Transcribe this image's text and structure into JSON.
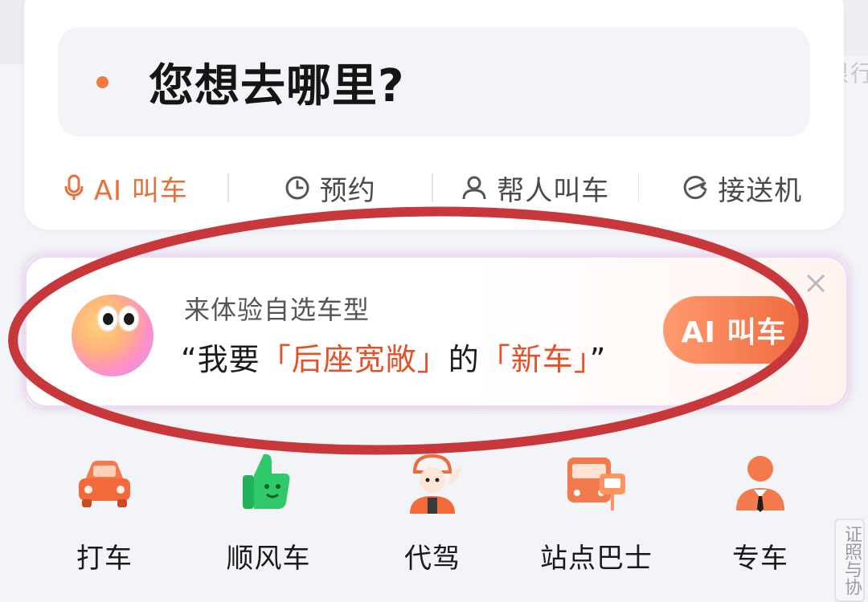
{
  "search": {
    "placeholder": "您想去哪里?"
  },
  "quick_actions": [
    {
      "label": "AI 叫车",
      "icon": "microphone-icon",
      "active": true
    },
    {
      "label": "预约",
      "icon": "clock-icon",
      "active": false
    },
    {
      "label": "帮人叫车",
      "icon": "person-icon",
      "active": false
    },
    {
      "label": "接送机",
      "icon": "airplane-icon",
      "active": false
    }
  ],
  "promo": {
    "subtitle": "来体验自选车型",
    "quote_open": "“我要",
    "highlight_1": "「后座宽敞」",
    "middle": "的",
    "highlight_2": "「新车」",
    "quote_close": "”",
    "button_label": "AI 叫车",
    "close_icon": "close-icon"
  },
  "services": [
    {
      "label": "打车",
      "icon": "car-icon"
    },
    {
      "label": "顺风车",
      "icon": "thumbs-up-icon"
    },
    {
      "label": "代驾",
      "icon": "driver-icon"
    },
    {
      "label": "站点巴士",
      "icon": "bus-icon"
    },
    {
      "label": "专车",
      "icon": "chauffeur-icon"
    }
  ],
  "side_tab": {
    "label": "证照与协"
  },
  "edge_text": "限行",
  "colors": {
    "accent": "#e8703a",
    "highlight": "#e3522a",
    "annotation": "#c8383a",
    "background": "#f3f4f8"
  }
}
